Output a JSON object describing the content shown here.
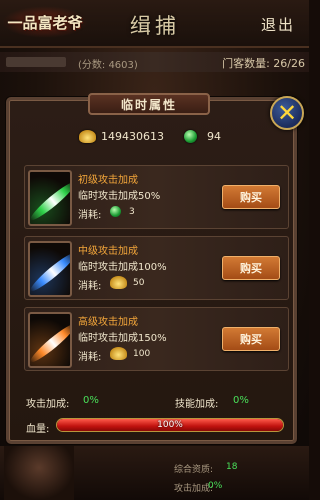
{
  "header": {
    "logo_text": "一品富老爷",
    "title": "缉捕",
    "exit_label": "退出"
  },
  "info_row": {
    "score_text": "(分数: 4603)",
    "retainer_count": "门客数量: 26/26"
  },
  "panel": {
    "title": "临时属性",
    "gold_value": "149430613",
    "gem_value": "94"
  },
  "items": [
    {
      "name": "初级攻击加成",
      "desc": "临时攻击加成50%",
      "cost_label": "消耗:",
      "cost_currency": "gem",
      "cost_value": "3",
      "buy_label": "购买",
      "color": "#2fd24a"
    },
    {
      "name": "中级攻击加成",
      "desc": "临时攻击加成100%",
      "cost_label": "消耗:",
      "cost_currency": "gold",
      "cost_value": "50",
      "buy_label": "购买",
      "color": "#3a8cff"
    },
    {
      "name": "高级攻击加成",
      "desc": "临时攻击加成150%",
      "cost_label": "消耗:",
      "cost_currency": "gold",
      "cost_value": "100",
      "buy_label": "购买",
      "color": "#ff8a2a"
    }
  ],
  "stats": {
    "attack_label": "攻击加成:",
    "attack_value": "0%",
    "skill_label": "技能加成:",
    "skill_value": "0%"
  },
  "hp": {
    "label": "血量:",
    "text": "100%",
    "fraction": 1.0
  },
  "bottom": {
    "line1_label": "综合资质:",
    "line1_value": "18",
    "line2_label": "攻击加成:",
    "line2_value": "0%"
  },
  "colors": {
    "accent_green": "#49e05a",
    "item_name": "#f3a63a",
    "buy_button": "#c0642a"
  }
}
